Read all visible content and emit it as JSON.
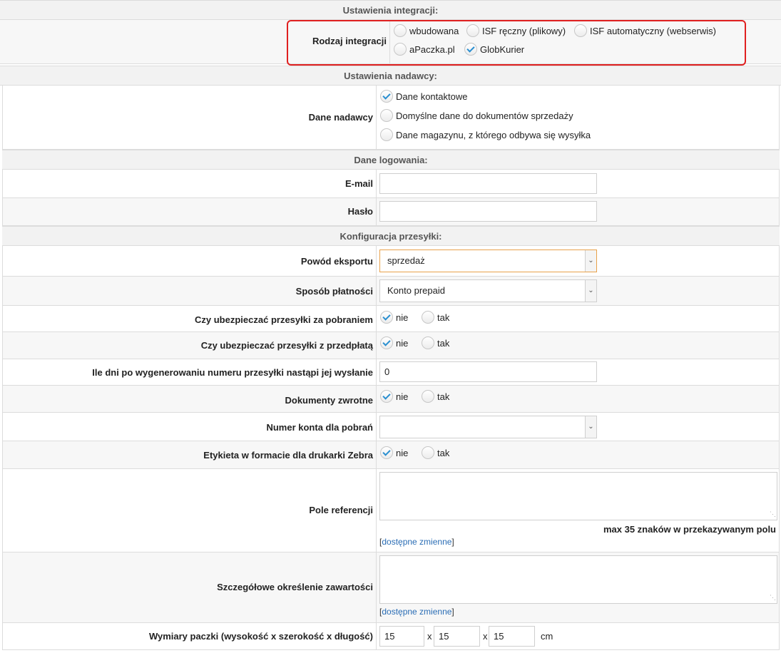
{
  "integration": {
    "header": "Ustawienia integracji:",
    "label": "Rodzaj integracji",
    "options": [
      {
        "label": "wbudowana",
        "checked": false
      },
      {
        "label": "ISF ręczny (plikowy)",
        "checked": false
      },
      {
        "label": "ISF automatyczny (webserwis)",
        "checked": false
      },
      {
        "label": "aPaczka.pl",
        "checked": false
      },
      {
        "label": "GlobKurier",
        "checked": true
      }
    ],
    "highlight_color": "#e02020"
  },
  "sender": {
    "header": "Ustawienia nadawcy:",
    "label": "Dane nadawcy",
    "options": [
      {
        "label": "Dane kontaktowe",
        "checked": true
      },
      {
        "label": "Domyślne dane do dokumentów sprzedaży",
        "checked": false
      },
      {
        "label": "Dane magazynu, z którego odbywa się wysyłka",
        "checked": false
      }
    ]
  },
  "login": {
    "header": "Dane logowania:",
    "email_label": "E-mail",
    "email_value": "",
    "password_label": "Hasło",
    "password_value": ""
  },
  "shipping": {
    "header": "Konfiguracja przesyłki:",
    "export_reason_label": "Powód eksportu",
    "export_reason_value": "sprzedaż",
    "payment_label": "Sposób płatności",
    "payment_value": "Konto prepaid",
    "insure_cod_label": "Czy ubezpieczać przesyłki za pobraniem",
    "insure_prepaid_label": "Czy ubezpieczać przesyłki z przedpłatą",
    "days_label": "Ile dni po wygenerowaniu numeru przesyłki nastąpi jej wysłanie",
    "days_value": "0",
    "return_docs_label": "Dokumenty zwrotne",
    "account_label": "Numer konta dla pobrań",
    "account_value": "",
    "zebra_label": "Etykieta w formacie dla drukarki Zebra",
    "yes_label": "tak",
    "no_label": "nie",
    "reference_label": "Pole referencji",
    "reference_value": "",
    "reference_note": "max 35 znaków w przekazywanym polu",
    "variables_link": "dostępne zmienne",
    "contents_label": "Szczegółowe określenie zawartości",
    "contents_value": "",
    "dimensions_label": "Wymiary paczki (wysokość x szerokość x długość)",
    "dim_height": "15",
    "dim_width": "15",
    "dim_length": "15",
    "dim_separator": "x",
    "dim_unit": "cm"
  },
  "colors": {
    "check": "#2a8fd0",
    "link": "#2a6db5",
    "focus_border": "#e8a14a"
  }
}
